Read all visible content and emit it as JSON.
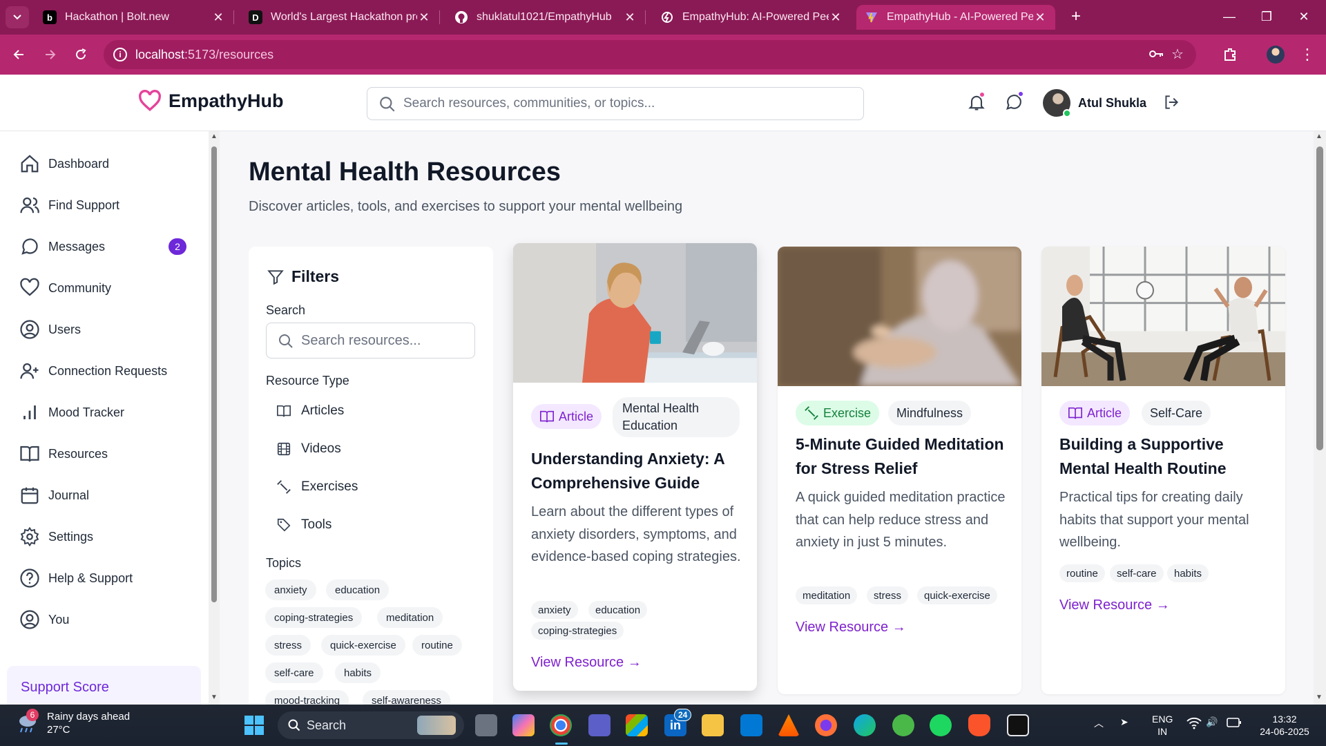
{
  "browser": {
    "tabs": [
      {
        "title": "Hackathon | Bolt.new",
        "favicon": "bolt-icon"
      },
      {
        "title": "World's Largest Hackathon presented by Bolt",
        "favicon": "devpost-icon"
      },
      {
        "title": "shuklatul1021/EmpathyHub",
        "favicon": "github-icon"
      },
      {
        "title": "EmpathyHub: AI-Powered Peer",
        "favicon": "bolt-spin-icon"
      },
      {
        "title": "EmpathyHub - AI-Powered Peer",
        "favicon": "vite-icon"
      }
    ],
    "address": {
      "host": "localhost",
      "path": ":5173/resources"
    }
  },
  "header": {
    "brand": "EmpathyHub",
    "search_placeholder": "Search resources, communities, or topics...",
    "user_name": "Atul Shukla"
  },
  "sidebar": {
    "items": [
      {
        "label": "Dashboard",
        "icon": "home-icon"
      },
      {
        "label": "Find Support",
        "icon": "users-icon"
      },
      {
        "label": "Messages",
        "icon": "message-icon",
        "badge": "2"
      },
      {
        "label": "Community",
        "icon": "heart-icon"
      },
      {
        "label": "Users",
        "icon": "user-circle-icon"
      },
      {
        "label": "Connection Requests",
        "icon": "user-plus-icon"
      },
      {
        "label": "Mood Tracker",
        "icon": "bar-chart-icon"
      },
      {
        "label": "Resources",
        "icon": "book-open-icon"
      },
      {
        "label": "Journal",
        "icon": "calendar-icon"
      },
      {
        "label": "Settings",
        "icon": "gear-icon"
      },
      {
        "label": "Help & Support",
        "icon": "help-circle-icon"
      },
      {
        "label": "You",
        "icon": "user-circle-icon"
      }
    ],
    "support_score": "Support Score"
  },
  "main": {
    "title": "Mental Health Resources",
    "subtitle": "Discover articles, tools, and exercises to support your mental wellbeing"
  },
  "filters": {
    "title": "Filters",
    "search_label": "Search",
    "search_placeholder": "Search resources...",
    "type_label": "Resource Type",
    "types": [
      "Articles",
      "Videos",
      "Exercises",
      "Tools"
    ],
    "topics_label": "Topics",
    "topics": [
      "anxiety",
      "education",
      "coping-strategies",
      "meditation",
      "stress",
      "quick-exercise",
      "routine",
      "self-care",
      "habits",
      "mood-tracking",
      "self-awareness"
    ]
  },
  "resources": [
    {
      "type": "Article",
      "category": "Mental Health Education",
      "title": "Understanding Anxiety: A Comprehensive Guide",
      "description": "Learn about the different types of anxiety disorders, symptoms, and evidence-based coping strategies.",
      "tags": [
        "anxiety",
        "education",
        "coping-strategies"
      ],
      "link": "View Resource →"
    },
    {
      "type": "Exercise",
      "category": "Mindfulness",
      "title": "5-Minute Guided Meditation for Stress Relief",
      "description": "A quick guided meditation practice that can help reduce stress and anxiety in just 5 minutes.",
      "tags": [
        "meditation",
        "stress",
        "quick-exercise"
      ],
      "link": "View Resource →"
    },
    {
      "type": "Article",
      "category": "Self-Care",
      "title": "Building a Supportive Mental Health Routine",
      "description": "Practical tips for creating daily habits that support your mental wellbeing.",
      "tags": [
        "routine",
        "self-care",
        "habits"
      ],
      "link": "View Resource →"
    }
  ],
  "taskbar": {
    "weather_badge": "6",
    "weather_line1": "Rainy days ahead",
    "weather_line2": "27°C",
    "search": "Search",
    "linkedin_badge": "24",
    "lang1": "ENG",
    "lang2": "IN",
    "time": "13:32",
    "date": "24-06-2025"
  },
  "colors": {
    "accent": "#7e22ce",
    "brand_pink": "#e5439a",
    "chrome": "#b5276f"
  }
}
